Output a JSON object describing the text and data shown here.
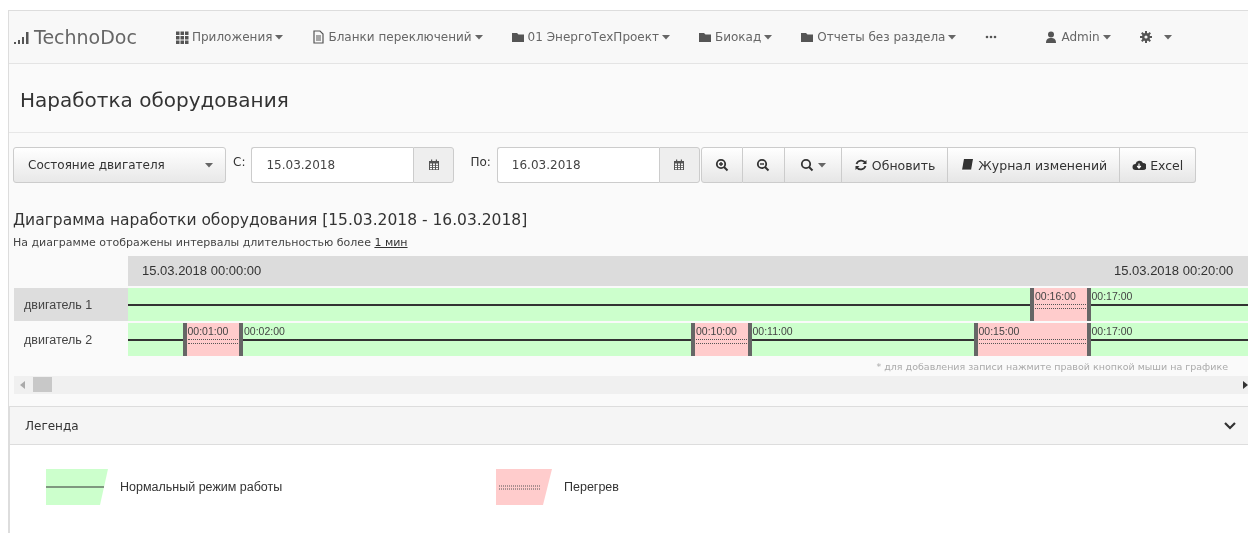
{
  "navbar": {
    "brand": "TechnoDoc",
    "items": [
      {
        "label": "Приложения"
      },
      {
        "label": "Бланки переключений"
      },
      {
        "label": "01 ЭнергоТехПроект"
      },
      {
        "label": "Биокад"
      },
      {
        "label": "Отчеты без раздела"
      },
      {
        "label": "Admin"
      }
    ]
  },
  "page_title": "Наработка оборудования",
  "toolbar": {
    "mode_select": {
      "value": "Состояние двигателя"
    },
    "from_label": "С:",
    "from_date": {
      "value": "15.03.2018"
    },
    "to_label": "По:",
    "to_date": {
      "value": "16.03.2018"
    },
    "buttons": [
      {
        "label": "Обновить"
      },
      {
        "label": "Журнал изменений"
      },
      {
        "label": "Excel"
      }
    ]
  },
  "chart_title": "Диаграмма наработки оборудования [15.03.2018 - 16.03.2018]",
  "chart_note": {
    "text": "На диаграмме отображены интервалы длительностью более",
    "link": "1 мин"
  },
  "timeline": {
    "header_labels": [
      "15.03.2018 00:00:00",
      "15.03.2018 00:20:00"
    ],
    "rows": [
      {
        "name": "двигатель 1",
        "selected": true,
        "segments": [
          {
            "kind": "overheat",
            "start": "00:16:00",
            "end": "00:17:00"
          }
        ]
      },
      {
        "name": "двигатель 2",
        "selected": false,
        "segments": [
          {
            "kind": "overheat",
            "start": "00:01:00",
            "end": "00:02:00"
          },
          {
            "kind": "overheat",
            "start": "00:10:00",
            "end": "00:11:00"
          },
          {
            "kind": "overheat",
            "start": "00:15:00",
            "end": "00:17:00"
          }
        ]
      }
    ],
    "hint": "* для добавления записи нажмите правой кнопкой мыши на графике"
  },
  "legend": {
    "title": "Легенда",
    "expanded": true,
    "items": [
      {
        "kind": "normal",
        "label": "Нормальный режим работы"
      },
      {
        "kind": "overheat",
        "label": "Перегрев"
      }
    ]
  }
}
